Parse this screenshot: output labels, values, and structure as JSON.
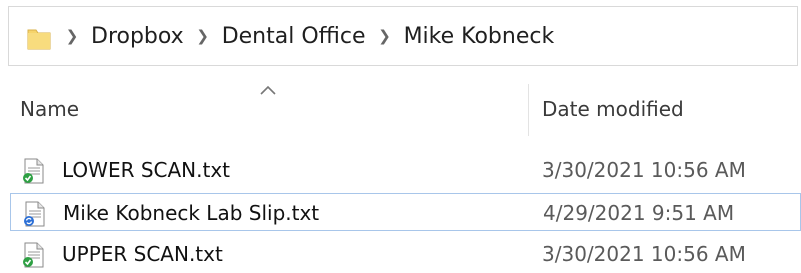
{
  "breadcrumb": {
    "items": [
      "Dropbox",
      "Dental Office",
      "Mike Kobneck"
    ]
  },
  "columns": {
    "name": "Name",
    "date_modified": "Date modified"
  },
  "files": [
    {
      "name": "LOWER SCAN.txt",
      "date_modified": "3/30/2021 10:56 AM",
      "sync_icon": "synced-check-icon"
    },
    {
      "name": "Mike Kobneck Lab Slip.txt",
      "date_modified": "4/29/2021 9:51 AM",
      "sync_icon": "syncing-icon"
    },
    {
      "name": "UPPER SCAN.txt",
      "date_modified": "3/30/2021 10:56 AM",
      "sync_icon": "synced-check-icon"
    }
  ],
  "colors": {
    "focus_border": "#a8c6ea",
    "synced_green": "#2ea043",
    "syncing_blue": "#2b6fd6",
    "folder_yellow": "#f6d46b"
  }
}
